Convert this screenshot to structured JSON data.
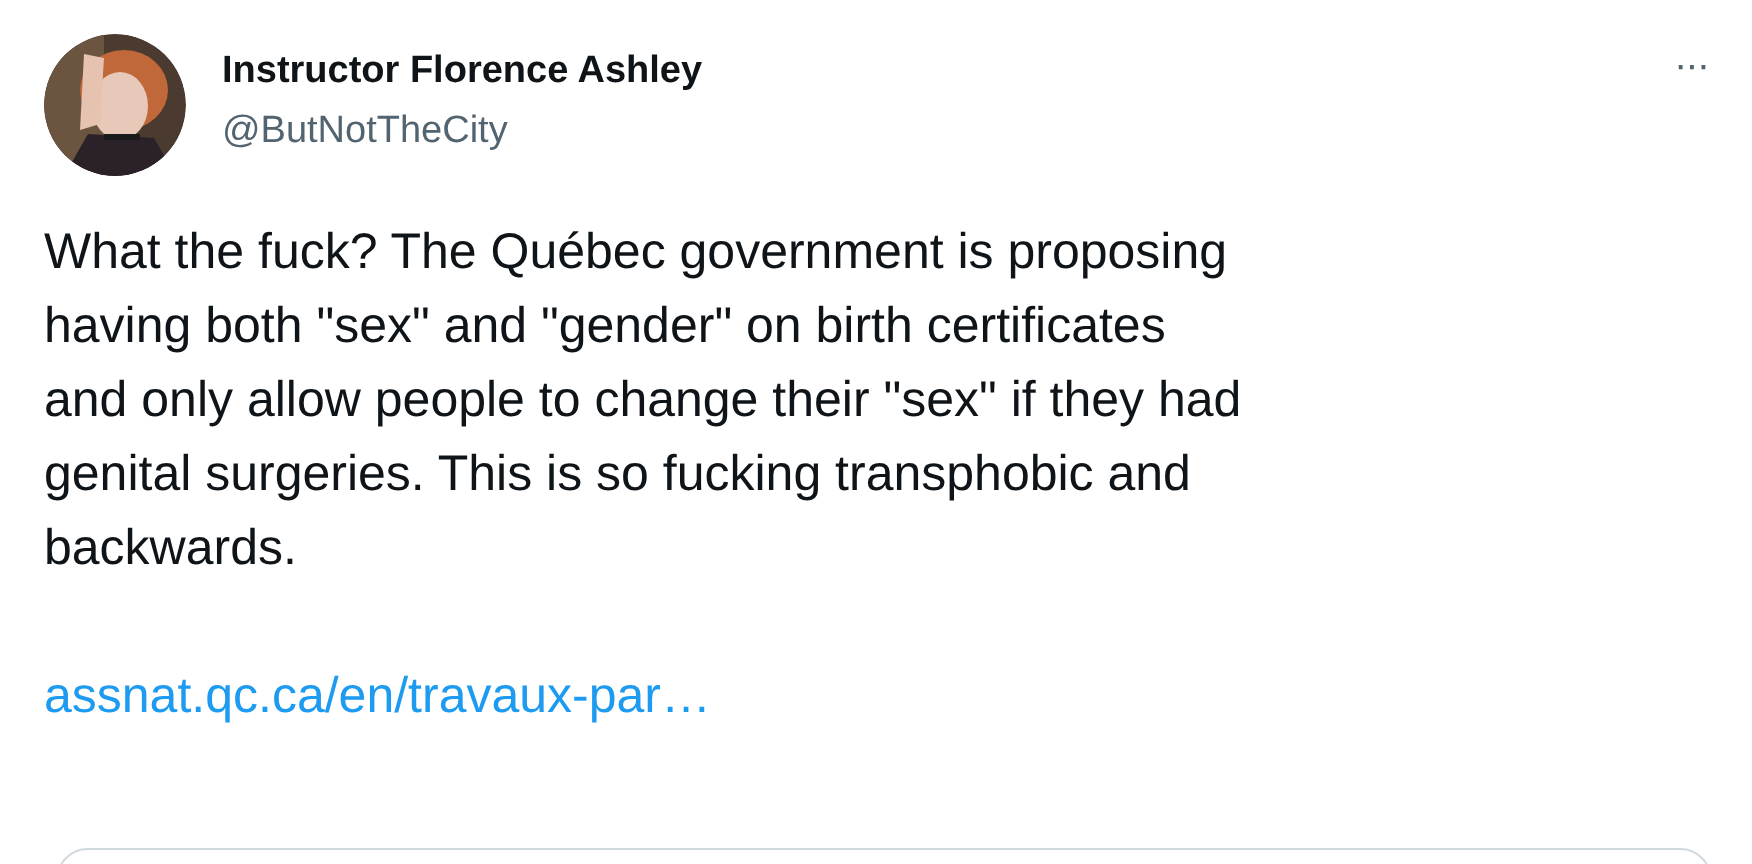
{
  "author": {
    "name": "Instructor Florence Ashley",
    "handle": "@ButNotTheCity"
  },
  "more_menu": "···",
  "tweet_text": "What the fuck? The Québec government is proposing\nhaving both \"sex\" and \"gender\" on birth certificates\nand only allow people to change their \"sex\" if they had\ngenital surgeries. This is so fucking transphobic and\nbackwards.",
  "link": "assnat.qc.ca/en/travaux-par…",
  "link_card": {
    "kind": "card"
  }
}
